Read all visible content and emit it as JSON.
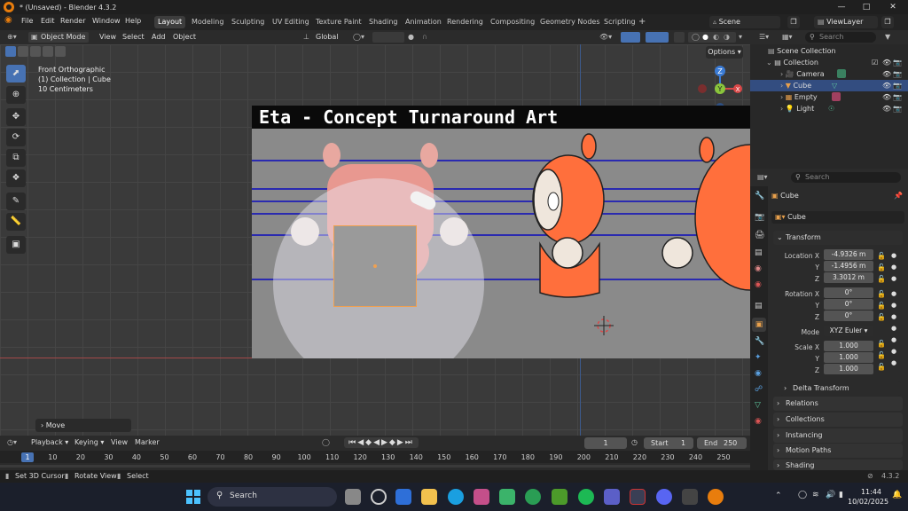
{
  "window": {
    "title": "* (Unsaved) - Blender 4.3.2"
  },
  "menubar": {
    "menus": [
      "File",
      "Edit",
      "Render",
      "Window",
      "Help"
    ],
    "workspaces": [
      "Layout",
      "Modeling",
      "Sculpting",
      "UV Editing",
      "Texture Paint",
      "Shading",
      "Animation",
      "Rendering",
      "Compositing",
      "Geometry Nodes",
      "Scripting"
    ],
    "active_workspace": "Layout",
    "add_tab": "+",
    "scene": "Scene",
    "view_layer": "ViewLayer"
  },
  "viewport_header": {
    "mode": "Object Mode",
    "menus": [
      "View",
      "Select",
      "Add",
      "Object"
    ],
    "orientation": "Global",
    "options": "Options"
  },
  "viewport": {
    "view_name": "Front Orthographic",
    "collection_info": "(1) Collection | Cube",
    "scale_info": "10 Centimeters",
    "reference_title": "Eta - Concept Turnaround Art",
    "last_operator": "Move",
    "gizmo_axes": [
      "Z",
      "Y",
      "X"
    ]
  },
  "tools": [
    "select-box-icon",
    "cursor-icon",
    "move-icon",
    "rotate-icon",
    "scale-icon",
    "transform-icon",
    "annotate-icon",
    "measure-icon",
    "add-cube-icon"
  ],
  "outliner": {
    "search_placeholder": "Search",
    "root": "Scene Collection",
    "collection": "Collection",
    "items": [
      "Camera",
      "Cube",
      "Empty",
      "Light"
    ],
    "selected": "Cube"
  },
  "properties": {
    "search_placeholder": "Search",
    "object_name": "Cube",
    "mesh_name": "Cube",
    "transform_header": "Transform",
    "location_label": "Location X",
    "location": [
      "-4.9326 m",
      "-1.4956 m",
      "3.3012 m"
    ],
    "rotation_label": "Rotation X",
    "rotation": [
      "0°",
      "0°",
      "0°"
    ],
    "mode_label": "Mode",
    "mode_value": "XYZ Euler",
    "scale_label": "Scale X",
    "scale": [
      "1.000",
      "1.000",
      "1.000"
    ],
    "axis_y": "Y",
    "axis_z": "Z",
    "delta_transform": "Delta Transform",
    "sections": [
      "Relations",
      "Collections",
      "Instancing",
      "Motion Paths",
      "Shading"
    ]
  },
  "timeline": {
    "menus": [
      "Playback",
      "Keying",
      "View",
      "Marker"
    ],
    "current_frame": "1",
    "start_label": "Start",
    "start_value": "1",
    "end_label": "End",
    "end_value": "250",
    "ruler": [
      "1",
      "10",
      "20",
      "30",
      "40",
      "50",
      "60",
      "70",
      "80",
      "90",
      "100",
      "110",
      "120",
      "130",
      "140",
      "150",
      "160",
      "170",
      "180",
      "190",
      "200",
      "210",
      "220",
      "230",
      "240",
      "250"
    ]
  },
  "statusbar": {
    "hints": [
      "Set 3D Cursor",
      "Rotate View",
      "Select"
    ],
    "version": "4.3.2"
  },
  "taskbar": {
    "search": "Search",
    "time": "11:44",
    "date": "10/02/2025"
  },
  "colors": {
    "accent": "#4772b3",
    "blender_orange": "#e87d0d",
    "selected_row": "#334d80"
  }
}
